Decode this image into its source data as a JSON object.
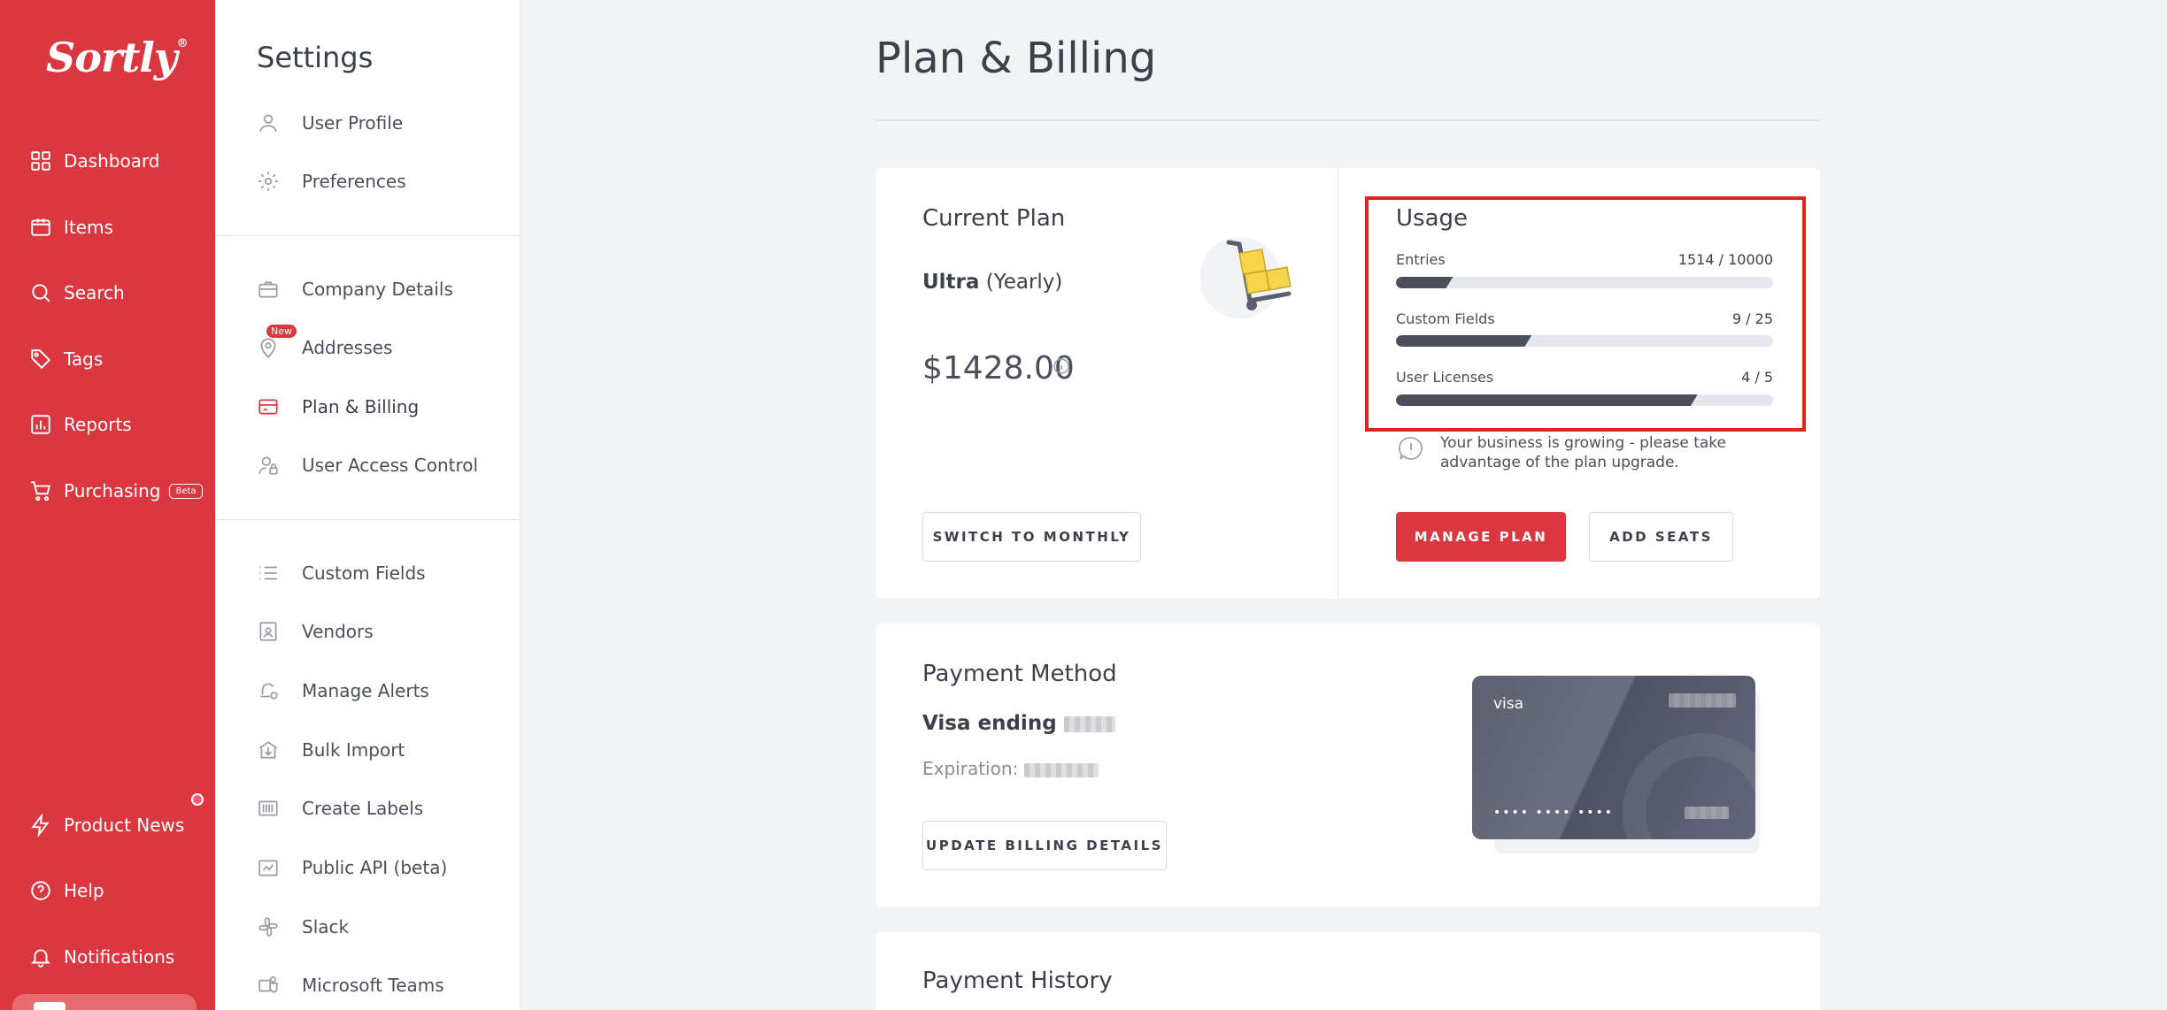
{
  "brand": {
    "logo": "Sortly",
    "logo_mark": "®"
  },
  "sidebar": {
    "items": [
      {
        "label": "Dashboard",
        "icon": "dashboard-icon"
      },
      {
        "label": "Items",
        "icon": "items-icon"
      },
      {
        "label": "Search",
        "icon": "search-icon"
      },
      {
        "label": "Tags",
        "icon": "tag-icon"
      },
      {
        "label": "Reports",
        "icon": "reports-icon"
      },
      {
        "label": "Purchasing",
        "icon": "cart-icon",
        "badge": "Beta"
      }
    ],
    "bottom_items": [
      {
        "label": "Product News",
        "icon": "lightning-icon"
      },
      {
        "label": "Help",
        "icon": "help-icon"
      },
      {
        "label": "Notifications",
        "icon": "bell-icon"
      }
    ]
  },
  "settings": {
    "title": "Settings",
    "group1": [
      {
        "label": "User Profile",
        "icon": "user-icon"
      },
      {
        "label": "Preferences",
        "icon": "gear-icon"
      }
    ],
    "group2": [
      {
        "label": "Company Details",
        "icon": "briefcase-icon"
      },
      {
        "label": "Addresses",
        "icon": "location-pin-icon",
        "badge": "New"
      },
      {
        "label": "Plan & Billing",
        "icon": "credit-card-icon",
        "active": true
      },
      {
        "label": "User Access Control",
        "icon": "user-lock-icon"
      }
    ],
    "group3": [
      {
        "label": "Custom Fields",
        "icon": "list-icon"
      },
      {
        "label": "Vendors",
        "icon": "vendor-icon"
      },
      {
        "label": "Manage Alerts",
        "icon": "bell-gear-icon"
      },
      {
        "label": "Bulk Import",
        "icon": "import-icon"
      },
      {
        "label": "Create Labels",
        "icon": "barcode-icon"
      },
      {
        "label": "Public API (beta)",
        "icon": "api-icon"
      },
      {
        "label": "Slack",
        "icon": "slack-icon"
      },
      {
        "label": "Microsoft Teams",
        "icon": "teams-icon"
      }
    ]
  },
  "page": {
    "title": "Plan & Billing"
  },
  "current_plan": {
    "heading": "Current Plan",
    "plan_name": "Ultra",
    "plan_period": "(Yearly)",
    "price": "$1428.00",
    "switch_label": "SWITCH TO MONTHLY"
  },
  "usage": {
    "heading": "Usage",
    "rows": [
      {
        "label": "Entries",
        "value": "1514 / 10000",
        "fraction": 0.1514
      },
      {
        "label": "Custom Fields",
        "value": "9 / 25",
        "fraction": 0.36
      },
      {
        "label": "User Licenses",
        "value": "4 / 5",
        "fraction": 0.8
      }
    ],
    "notice": "Your business is growing - please take advantage of the plan upgrade.",
    "manage_label": "MANAGE PLAN",
    "add_seats_label": "ADD SEATS"
  },
  "payment": {
    "heading": "Payment Method",
    "visa_text": "Visa ending",
    "expiration_label": "Expiration:",
    "update_label": "UPDATE BILLING DETAILS",
    "card_brand": "visa",
    "card_dots": "•••• •••• ••••"
  },
  "history": {
    "heading": "Payment History"
  },
  "colors": {
    "accent": "#db3740",
    "highlight_box": "#e1251b",
    "bar_fill": "#4b4f5c"
  }
}
